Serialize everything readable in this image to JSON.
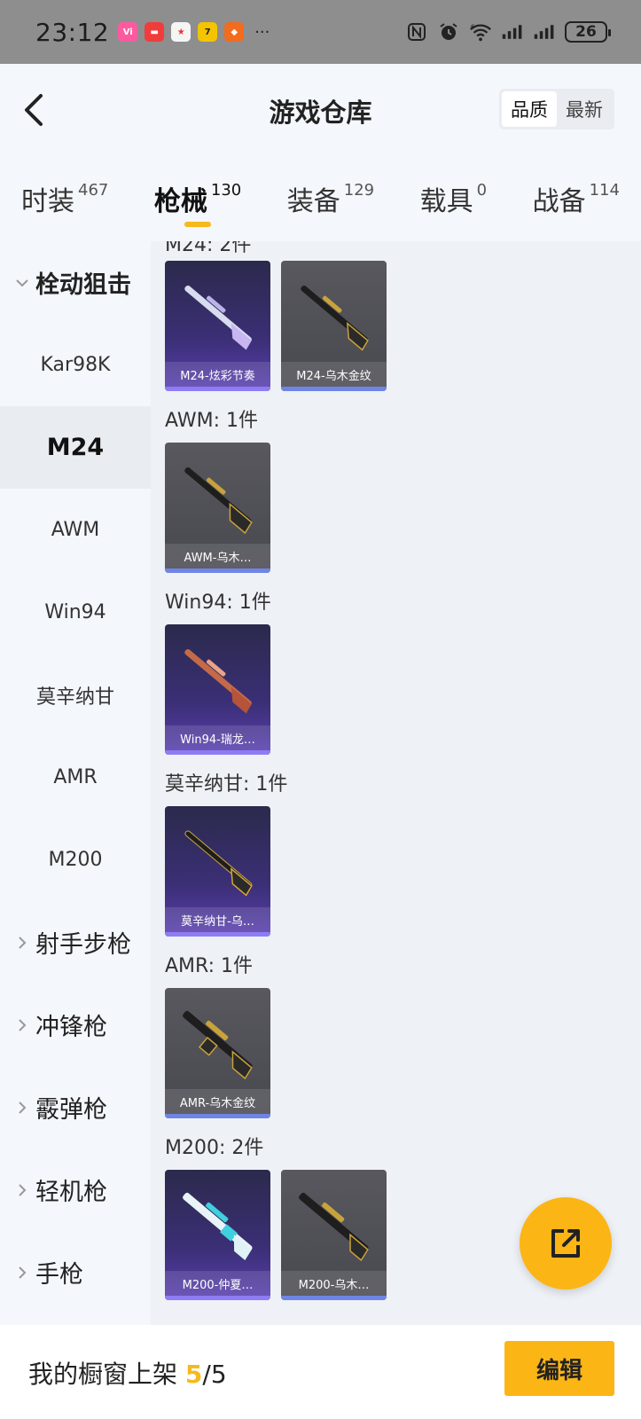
{
  "status_bar": {
    "time": "23:12",
    "battery": "26",
    "network": "6"
  },
  "header": {
    "title": "游戏仓库",
    "sort_options": [
      "品质",
      "最新"
    ],
    "sort_active": "品质"
  },
  "tabs": [
    {
      "label": "时装",
      "count": "467"
    },
    {
      "label": "枪械",
      "count": "130"
    },
    {
      "label": "装备",
      "count": "129"
    },
    {
      "label": "载具",
      "count": "0"
    },
    {
      "label": "战备",
      "count": "114"
    }
  ],
  "active_tab": "枪械",
  "sidebar": {
    "open_category": "栓动狙击",
    "sub_items": [
      "Kar98K",
      "M24",
      "AWM",
      "Win94",
      "莫辛纳甘",
      "AMR",
      "M200"
    ],
    "active_sub_item": "M24",
    "categories": [
      "射手步枪",
      "冲锋枪",
      "霰弹枪",
      "轻机枪",
      "手枪"
    ]
  },
  "content": {
    "partial_header": "M24: 2件",
    "groups": [
      {
        "title": "",
        "items": [
          {
            "name": "M24-炫彩节奏",
            "quality": "purple",
            "gun_color": "silver"
          },
          {
            "name": "M24-乌木金纹",
            "quality": "grey",
            "gun_color": "gold"
          }
        ]
      },
      {
        "title": "AWM: 1件",
        "items": [
          {
            "name": "AWM-乌木…",
            "quality": "grey",
            "gun_color": "gold"
          }
        ]
      },
      {
        "title": "Win94: 1件",
        "items": [
          {
            "name": "Win94-瑞龙…",
            "quality": "purple",
            "gun_color": "red"
          }
        ]
      },
      {
        "title": "莫辛纳甘: 1件",
        "items": [
          {
            "name": "莫辛纳甘-乌…",
            "quality": "purple",
            "gun_color": "gold"
          }
        ]
      },
      {
        "title": "AMR: 1件",
        "items": [
          {
            "name": "AMR-乌木金纹",
            "quality": "grey",
            "gun_color": "gold"
          }
        ]
      },
      {
        "title": "M200: 2件",
        "items": [
          {
            "name": "M200-仲夏…",
            "quality": "purple",
            "gun_color": "cyan"
          },
          {
            "name": "M200-乌木…",
            "quality": "grey",
            "gun_color": "gold"
          }
        ]
      }
    ]
  },
  "bottom_bar": {
    "label": "我的橱窗上架",
    "count": "5",
    "total": "/5",
    "edit_label": "编辑"
  },
  "colors": {
    "accent": "#fbb515",
    "purple_quality": "#8e7cf5",
    "grey_quality": "#6f85e6"
  }
}
